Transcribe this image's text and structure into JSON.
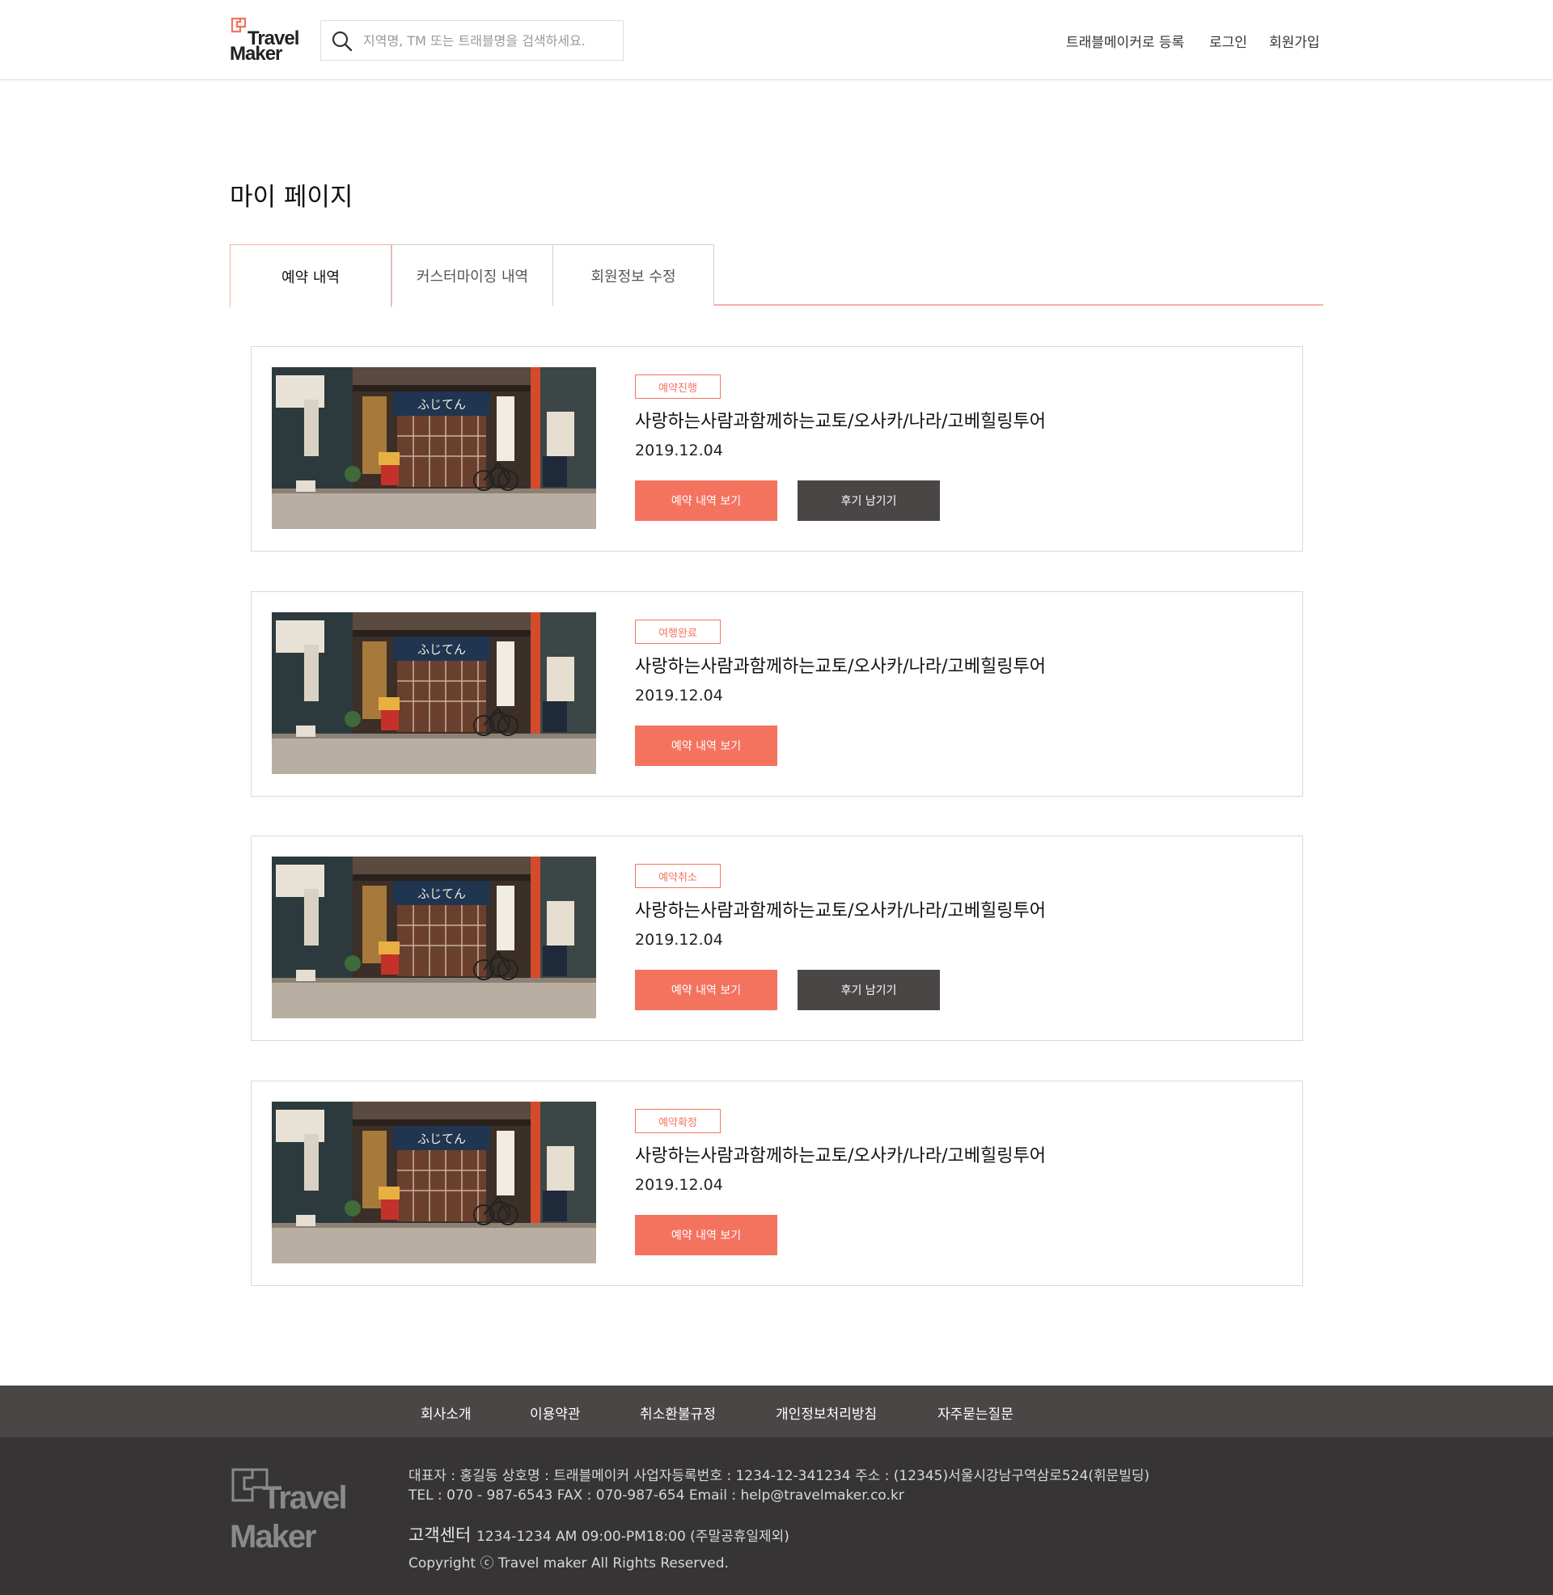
{
  "brand": {
    "line1": "Travel",
    "line2": "Maker"
  },
  "search": {
    "placeholder": "지역명, TM 또는 트래블명을 검색하세요."
  },
  "nav": {
    "register": "트래블메이커로 등록",
    "login": "로그인",
    "signup": "회원가입"
  },
  "page": {
    "title": "마이 페이지"
  },
  "tabs": [
    {
      "label": "예약 내역",
      "active": true
    },
    {
      "label": "커스터마이징 내역",
      "active": false
    },
    {
      "label": "회원정보 수정",
      "active": false
    }
  ],
  "reservations": [
    {
      "status": "예약진행",
      "title": "사랑하는사람과함께하는교토/오사카/나라/고베힐링투어",
      "date": "2019.12.04",
      "view_label": "예약 내역 보기",
      "review_label": "후기 남기기"
    },
    {
      "status": "여행완료",
      "title": "사랑하는사람과함께하는교토/오사카/나라/고베힐링투어",
      "date": "2019.12.04",
      "view_label": "예약 내역 보기"
    },
    {
      "status": "예약취소",
      "title": "사랑하는사람과함께하는교토/오사카/나라/고베힐링투어",
      "date": "2019.12.04",
      "view_label": "예약 내역 보기",
      "review_label": "후기 남기기"
    },
    {
      "status": "예약확정",
      "title": "사랑하는사람과함께하는교토/오사카/나라/고베힐링투어",
      "date": "2019.12.04",
      "view_label": "예약 내역 보기"
    }
  ],
  "footer": {
    "links": [
      "회사소개",
      "이용약관",
      "취소환불규정",
      "개인정보처리방침",
      "자주묻는질문"
    ],
    "info_line1": "대표자 : 홍길동    상호명 : 트래블메이커    사업자등록번호 : 1234-12-341234    주소 : (12345)서울시강남구역삼로524(휘문빌딩)",
    "info_line2": "TEL : 070 - 987-6543    FAX : 070-987-654    Email : help@travelmaker.co.kr",
    "cs_label": "고객센터",
    "cs_detail": "1234-1234   AM 09:00-PM18:00 (주말공휴일제외)",
    "copyright": "Copyright ⓒ Travel maker All Rights Reserved."
  },
  "colors": {
    "accent": "#f4735f",
    "dark_button": "#4a4646",
    "footer_nav": "#4a4646",
    "footer_bg": "#363434",
    "tab_border": "#f7b0a4"
  },
  "icons": {
    "search": "search-icon",
    "logo": "travel-maker-logo"
  }
}
